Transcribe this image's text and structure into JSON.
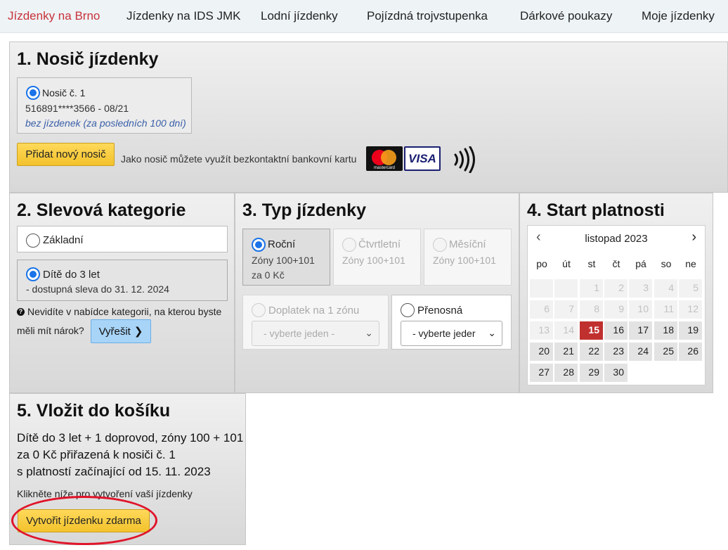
{
  "nav": {
    "items": [
      "Jízdenky na Brno",
      "Jízdenky na IDS JMK",
      "Lodní jízdenky",
      "Pojízdná trojvstupenka",
      "Dárkové poukazy",
      "Moje jízdenky"
    ]
  },
  "section1": {
    "title": "1. Nosič jízdenky",
    "carrier_label": "Nosič č. 1",
    "carrier_number": "516891****3566 - 08/21",
    "carrier_note": "bez jízdenek (za posledních 100 dní)",
    "add_button": "Přidat nový nosič",
    "hint": "Jako nosič můžete využít bezkontaktní bankovní kartu",
    "mastercard_text": "mastercard",
    "visa_text": "VISA"
  },
  "section2": {
    "title": "2. Slevová kategorie",
    "option_basic": "Základní",
    "option_child": "Dítě do 3 let",
    "option_child_note": "- dostupná sleva do 31. 12. 2024",
    "help_line1": "Nevidíte v nabídce kategorii, na kterou byste",
    "help_line2": "měli mít nárok?",
    "resolve_button": "Vyřešit"
  },
  "section3": {
    "title": "3. Typ jízdenky",
    "tiles": [
      {
        "label": "Roční",
        "sub1": "Zóny 100+101",
        "sub2": "za 0 Kč"
      },
      {
        "label": "Čtvrtletní",
        "sub1": "Zóny 100+101",
        "sub2": ""
      },
      {
        "label": "Měsíční",
        "sub1": "Zóny 100+101",
        "sub2": ""
      }
    ],
    "zone_addon_label": "Doplatek na 1 zónu",
    "zone_addon_select": "- vyberte jeden -",
    "transferable_label": "Přenosná",
    "transferable_select": "- vyberte jeder"
  },
  "section4": {
    "title": "4. Start platnosti",
    "month": "listopad 2023",
    "weekdays": [
      "po",
      "út",
      "st",
      "čt",
      "pá",
      "so",
      "ne"
    ],
    "rows": [
      [
        "",
        "",
        "1",
        "2",
        "3",
        "4",
        "5"
      ],
      [
        "6",
        "7",
        "8",
        "9",
        "10",
        "11",
        "12"
      ],
      [
        "13",
        "14",
        "15",
        "16",
        "17",
        "18",
        "19"
      ],
      [
        "20",
        "21",
        "22",
        "23",
        "24",
        "25",
        "26"
      ],
      [
        "27",
        "28",
        "29",
        "30",
        "",
        "",
        ""
      ]
    ],
    "selected_day": "15",
    "first_available_day": 15
  },
  "section5": {
    "title": "5. Vložit do košíku",
    "summary_line1": "Dítě do 3 let + 1 doprovod, zóny 100 + 101",
    "summary_line2": "za 0 Kč přiřazená k nosiči č. 1",
    "summary_line3": "s platností začínající od 15. 11. 2023",
    "instruction": "Klikněte níže pro vytvoření vaší jízdenky",
    "create_button": "Vytvořit jízdenku zdarma"
  },
  "colors": {
    "accent_red": "#c8323a",
    "button_yellow": "#f3c22c",
    "button_blue": "#a8d4f7",
    "radio_blue": "#1a73e8",
    "highlight_ellipse": "#e0142a"
  }
}
